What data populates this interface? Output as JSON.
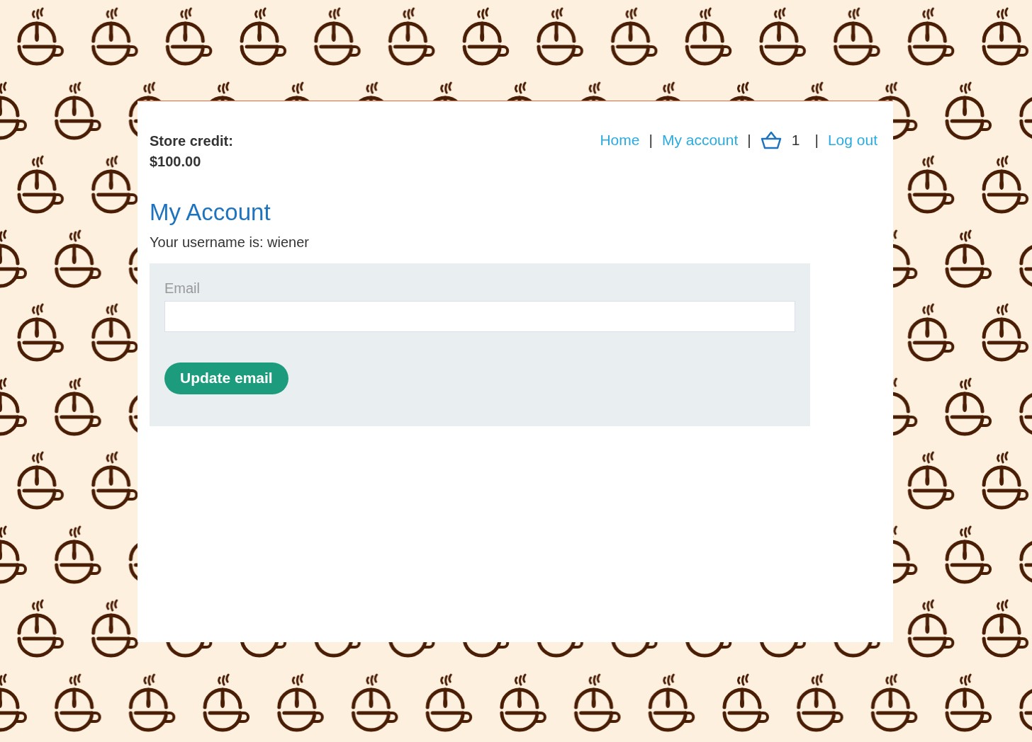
{
  "store_credit": {
    "label": "Store credit:",
    "amount": "$100.00"
  },
  "nav": {
    "links": [
      {
        "kind": "link",
        "label": "Home"
      },
      {
        "kind": "separator",
        "label": "|"
      },
      {
        "kind": "link",
        "label": "My account"
      },
      {
        "kind": "separator",
        "label": "|"
      },
      {
        "kind": "cart",
        "count": "1"
      },
      {
        "kind": "separator",
        "label": "|"
      },
      {
        "kind": "link",
        "label": "Log out"
      }
    ]
  },
  "heading": "My Account",
  "username_text": "Your username is: wiener",
  "form": {
    "field_label": "Email",
    "button": "Update email"
  }
}
